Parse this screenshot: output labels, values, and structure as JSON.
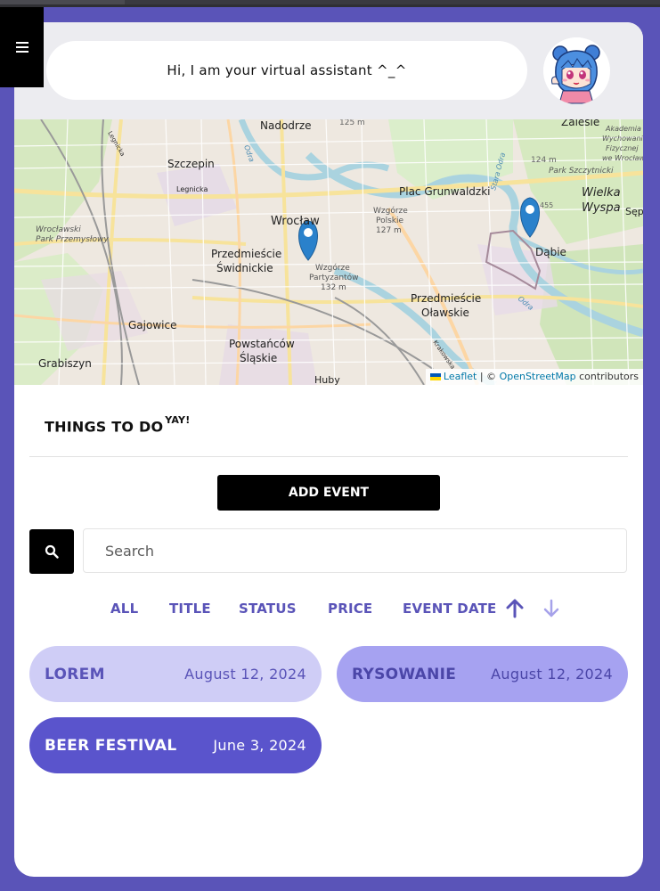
{
  "assistant": {
    "message": "Hi, I am your virtual assistant ^_^",
    "avatar_icon": "anime-girl-avatar"
  },
  "map": {
    "labels": {
      "nadodrze": "Nadodrze",
      "szczepin": "Szczepin",
      "legnicka1": "Legnicka",
      "legnicka2": "Legnicka",
      "wroclaw": "Wrocław",
      "plac": "Plac Grunwaldzki",
      "wielka1": "Wielka",
      "wielka2": "Wyspa",
      "zalesie": "Zalesie",
      "dabie": "Dąbie",
      "park_prz1": "Wrocławski",
      "park_prz2": "Park Przemysłowy",
      "przedm_sw1": "Przedmieście",
      "przedm_sw2": "Świdnickie",
      "wzgorze_p1": "Wzgórze",
      "wzgorze_p2": "Partyzantów",
      "wzgorze_p3": "132 m",
      "wzgorze_pol1": "Wzgórze",
      "wzgorze_pol2": "Polskie",
      "wzgorze_pol3": "127 m",
      "przedm_ol1": "Przedmieście",
      "przedm_ol2": "Oławskie",
      "gajowice": "Gajowice",
      "powst1": "Powstańców",
      "powst2": "Śląskie",
      "grabiszyn": "Grabiszyn",
      "huby": "Huby",
      "park_szcz": "Park Szczytnicki",
      "akad1": "Akademia",
      "akad2": "Wychowania",
      "akad3": "Fizycznej",
      "akad4": "we Wrocławiu",
      "sep": "Sęp",
      "elev125": "125 m",
      "elev124": "124 m",
      "elev455": "455",
      "odra1": "Odra",
      "odra2": "Stara Odra",
      "odra3": "Odra",
      "krakowska": "Krakowska"
    },
    "attribution": {
      "leaflet": "Leaflet",
      "separator": "| ©",
      "osm": "OpenStreetMap",
      "contributors": "contributors"
    }
  },
  "section": {
    "title": "THINGS TO DO",
    "superscript": "YAY!"
  },
  "add_event_label": "ADD EVENT",
  "search": {
    "placeholder": "Search",
    "icon": "search-icon"
  },
  "filters": {
    "all": "ALL",
    "title": "TITLE",
    "status": "STATUS",
    "price": "PRICE",
    "event_date": "EVENT DATE"
  },
  "sort": {
    "asc_icon": "arrow-up-icon",
    "desc_icon": "arrow-down-icon",
    "active": "asc"
  },
  "events": [
    {
      "title": "LOREM",
      "date": "August 12, 2024"
    },
    {
      "title": "RYSOWANIE",
      "date": "August 12, 2024"
    },
    {
      "title": "BEER FESTIVAL",
      "date": "June 3, 2024"
    }
  ],
  "colors": {
    "page_bg": "#5a54b8",
    "accent": "#5a54b8",
    "event_light": "#cfcdf6",
    "event_mid": "#a6a2f1",
    "event_dark": "#5a54cc",
    "marker": "#2a81cb"
  }
}
